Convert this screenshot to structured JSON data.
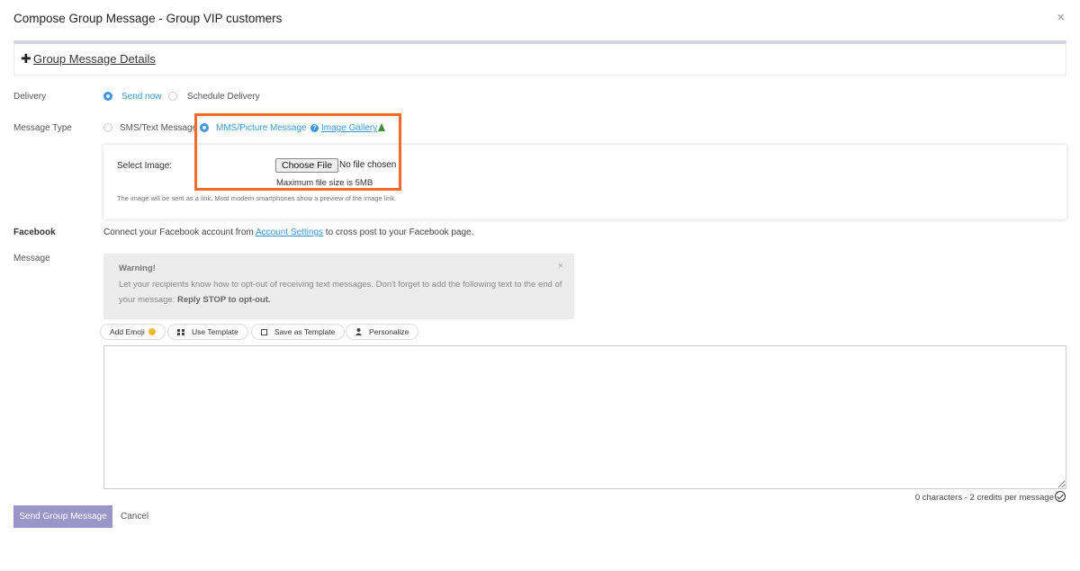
{
  "modal": {
    "title": "Compose Group Message - Group VIP customers",
    "close": "×"
  },
  "details": {
    "toggle": "✚",
    "link": "Group Message Details"
  },
  "delivery": {
    "label": "Delivery",
    "options": [
      {
        "label": "Send now",
        "selected": true
      },
      {
        "label": "Schedule Delivery",
        "selected": false
      }
    ]
  },
  "message_type": {
    "label": "Message Type",
    "options": [
      {
        "label": "SMS/Text Message",
        "selected": false
      },
      {
        "label": "MMS/Picture Message",
        "selected": true
      }
    ],
    "help_icon": "?",
    "gallery_link": "Image Gallery"
  },
  "image_panel": {
    "select_label": "Select Image:",
    "choose_button": "Choose File",
    "file_status": "No file chosen",
    "max_size": "Maximum file size is 5MB",
    "hint": "The image will be sent as a link. Most modern smartphones show a preview of the image link."
  },
  "facebook": {
    "label": "Facebook",
    "text_before": "Connect your Facebook account from ",
    "link": "Account Settings",
    "text_after": " to cross post to your Facebook page."
  },
  "message": {
    "label": "Message",
    "warning_title": "Warning!",
    "warning_close": "×",
    "warning_body": "Let your recipients know how to opt-out of receiving text messages. Don't forget to add the following text to the end of your message: ",
    "warning_bold": "Reply STOP to opt-out.",
    "textarea_value": ""
  },
  "toolbar": {
    "add_emoji": "Add Emoji",
    "use_template": "Use Template",
    "save_template": "Save as Template",
    "personalize": "Personalize"
  },
  "counter": "0 characters - 2 credits per message",
  "actions": {
    "send": "Send Group Message",
    "cancel": "Cancel"
  },
  "colors": {
    "accent": "#3d97e6",
    "highlight": "#f26b2a",
    "send_button": "#9b96c8"
  }
}
